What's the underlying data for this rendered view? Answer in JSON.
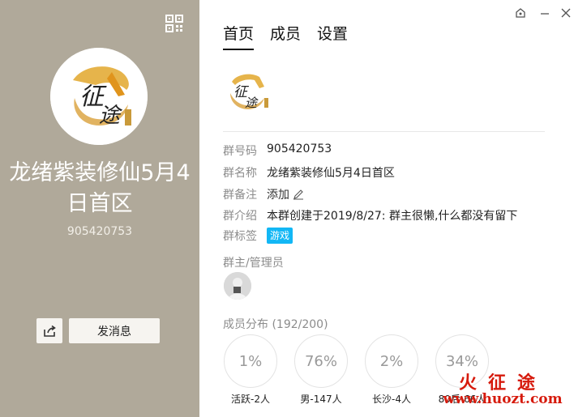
{
  "left": {
    "title": "龙绪紫装修仙5月4日首区",
    "number": "905420753",
    "send_label": "发消息"
  },
  "tabs": [
    "首页",
    "成员",
    "设置"
  ],
  "info": {
    "id_key": "群号码",
    "id_val": "905420753",
    "name_key": "群名称",
    "name_val": "龙绪紫装修仙5月4日首区",
    "remark_key": "群备注",
    "remark_val": "添加",
    "intro_key": "群介绍",
    "intro_val": "本群创建于2019/8/27:  群主很懒,什么都没有留下",
    "tag_key": "群标签",
    "tag_val": "游戏"
  },
  "admin_title": "群主/管理员",
  "member_title": "成员分布 (192/200)",
  "stats": [
    {
      "value": "1%",
      "label": "活跃-2人"
    },
    {
      "value": "76%",
      "label": "男-147人"
    },
    {
      "value": "2%",
      "label": "长沙-4人"
    },
    {
      "value": "34%",
      "label": "80后-66人"
    }
  ],
  "watermark": {
    "line1": "火征途",
    "line2": "www.huozt.com"
  },
  "colors": {
    "left_bg": "#b0a99a",
    "tag_bg": "#12b7f5",
    "watermark": "#d61a0c"
  }
}
